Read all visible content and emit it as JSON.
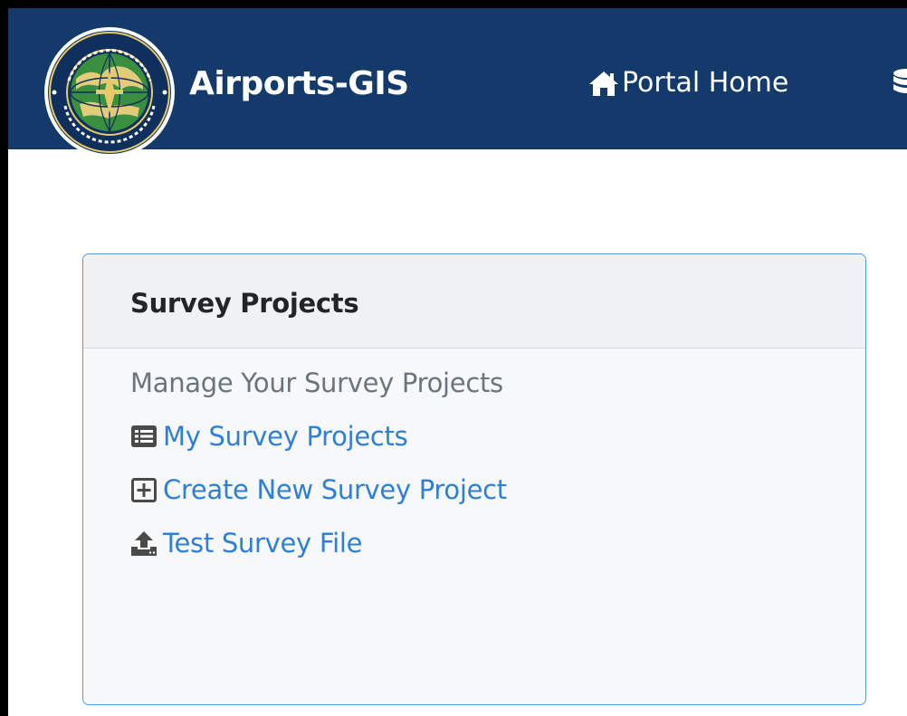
{
  "navbar": {
    "brand": "Airports-GIS",
    "seal_icon": "faa-seal-icon",
    "home_icon": "home-icon",
    "home_label": "Portal Home",
    "next_icon": "database-icon",
    "background": "#133a6b"
  },
  "card": {
    "title": "Survey Projects",
    "subtitle": "Manage Your Survey Projects",
    "links": [
      {
        "label": "My Survey Projects",
        "icon": "list-icon"
      },
      {
        "label": "Create New Survey Project",
        "icon": "plus-square-icon"
      },
      {
        "label": "Test Survey File",
        "icon": "upload-icon"
      }
    ],
    "border_color": "#5b9bd5",
    "link_color": "#2f7fd9"
  }
}
